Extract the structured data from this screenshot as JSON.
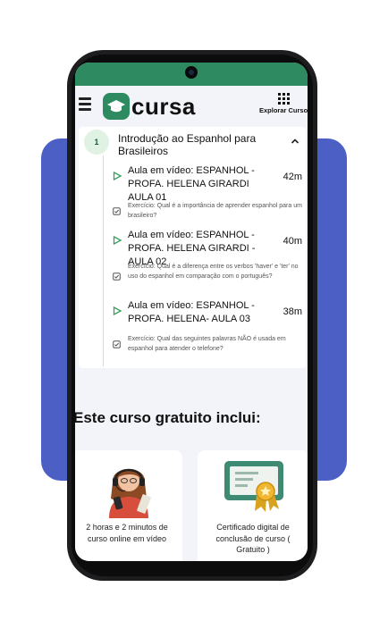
{
  "colors": {
    "brand": "#2e8a60",
    "panel": "#4b5fc4",
    "play": "#3aa05e"
  },
  "header": {
    "menu_icon": "hamburger-menu-icon",
    "logo_text": "cursa",
    "explore_icon": "grid-icon",
    "explore_label": "Explorar Curso"
  },
  "module": {
    "number": "1",
    "title": "Introdução ao Espanhol para Brasileiros",
    "toggle_icon": "chevron-up-icon",
    "items": [
      {
        "kind": "video",
        "icon": "play-icon",
        "title": "Aula em vídeo: ESPANHOL - PROFA. HELENA GIRARDI AULA 01",
        "duration": "42m"
      },
      {
        "kind": "exercise",
        "icon": "checkbox-icon",
        "text": "Exercício: Qual é a importância de aprender espanhol para um brasileiro?"
      },
      {
        "kind": "video",
        "icon": "play-icon",
        "title": "Aula em vídeo: ESPANHOL - PROFA. HELENA GIRARDI -AULA 02",
        "duration": "40m"
      },
      {
        "kind": "exercise",
        "icon": "checkbox-icon",
        "text": "Exercício: Qual é a diferença entre os verbos 'haver' e 'ter' no uso do espanhol em comparação com o português?"
      },
      {
        "kind": "video",
        "icon": "play-icon",
        "title": "Aula em vídeo: ESPANHOL - PROFA. HELENA- AULA 03",
        "duration": "38m"
      },
      {
        "kind": "exercise",
        "icon": "checkbox-icon",
        "text": "Exercício: Qual das seguintes palavras NÃO é usada em espanhol para atender o telefone?"
      }
    ]
  },
  "includes": {
    "title": "Este curso gratuito inclui:",
    "features": [
      {
        "icon": "woman-with-headset-illustration",
        "label": "2 horas e 2 minutos de curso online em vídeo"
      },
      {
        "icon": "certificate-illustration",
        "label": "Certificado digital de conclusão de curso ( Gratuito )"
      }
    ]
  }
}
